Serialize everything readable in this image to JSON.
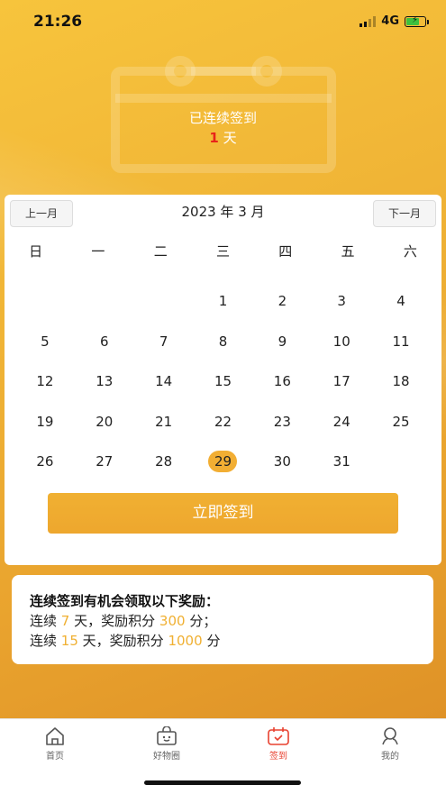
{
  "status_bar": {
    "time": "21:26",
    "network": "4G"
  },
  "header": {
    "streak_label": "已连续签到",
    "streak_days": "1",
    "streak_unit": "天"
  },
  "calendar": {
    "prev_label": "上一月",
    "next_label": "下一月",
    "month_title": "2023 年 3 月",
    "weekdays": [
      "日",
      "一",
      "二",
      "三",
      "四",
      "五",
      "六"
    ],
    "days": [
      "",
      "",
      "",
      "1",
      "2",
      "3",
      "4",
      "5",
      "6",
      "7",
      "8",
      "9",
      "10",
      "11",
      "12",
      "13",
      "14",
      "15",
      "16",
      "17",
      "18",
      "19",
      "20",
      "21",
      "22",
      "23",
      "24",
      "25",
      "26",
      "27",
      "28",
      "29",
      "30",
      "31",
      ""
    ],
    "today": "29",
    "signin_label": "立即签到"
  },
  "rewards": {
    "title": "连续签到有机会领取以下奖励：",
    "line1": {
      "prefix": "连续",
      "days": "7",
      "mid": "天，奖励积分",
      "points": "300",
      "suffix": "分；"
    },
    "line2": {
      "prefix": "连续",
      "days": "15",
      "mid": "天，奖励积分",
      "points": "1000",
      "suffix": "分"
    }
  },
  "tabs": [
    {
      "label": "首页",
      "icon": "home-icon"
    },
    {
      "label": "好物圈",
      "icon": "shop-bag-icon"
    },
    {
      "label": "签到",
      "icon": "calendar-check-icon"
    },
    {
      "label": "我的",
      "icon": "user-icon"
    }
  ],
  "colors": {
    "accent": "#f0b032",
    "active_tab": "#e8402f",
    "streak_count": "#e8231a"
  }
}
